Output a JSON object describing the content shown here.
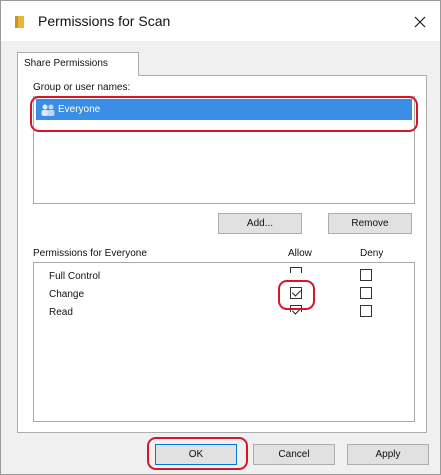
{
  "window": {
    "title": "Permissions for Scan",
    "close_glyph": "✕"
  },
  "tabs": [
    {
      "label": "Share Permissions",
      "active": true
    }
  ],
  "group_section": {
    "label": "Group or user names:",
    "items": [
      {
        "name": "Everyone",
        "selected": true,
        "icon": "users-icon"
      }
    ]
  },
  "group_buttons": {
    "add_label": "Add...",
    "remove_label": "Remove"
  },
  "permissions_section": {
    "label": "Permissions for Everyone",
    "allow_header": "Allow",
    "deny_header": "Deny",
    "rows": [
      {
        "name": "Full Control",
        "allow": false,
        "deny": false
      },
      {
        "name": "Change",
        "allow": true,
        "deny": false
      },
      {
        "name": "Read",
        "allow": true,
        "deny": false
      }
    ]
  },
  "dialog_buttons": {
    "ok_label": "OK",
    "cancel_label": "Cancel",
    "apply_label": "Apply"
  },
  "colors": {
    "selection": "#3a8ee6",
    "highlight_ring": "#d7152a",
    "folder": "#e8b63a"
  }
}
